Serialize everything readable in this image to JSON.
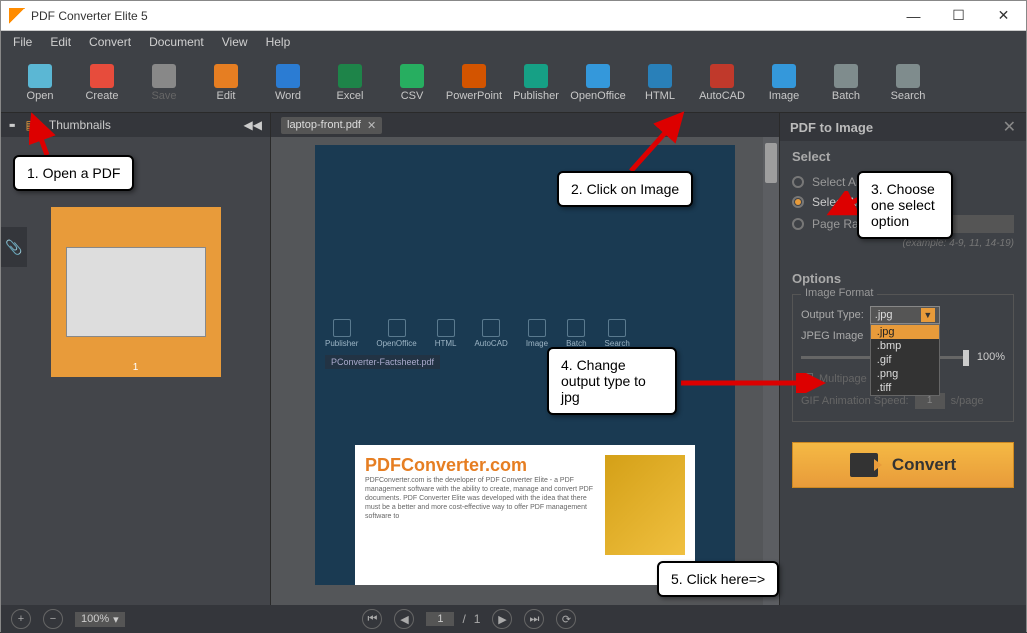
{
  "app": {
    "title": "PDF Converter Elite 5"
  },
  "menu": [
    "File",
    "Edit",
    "Convert",
    "Document",
    "View",
    "Help"
  ],
  "toolbar": [
    {
      "label": "Open",
      "color": "#5bb7d4",
      "icon": "folder"
    },
    {
      "label": "Create",
      "color": "#e74c3c",
      "icon": "pdf"
    },
    {
      "label": "Save",
      "color": "#888",
      "icon": "disk",
      "disabled": true
    },
    {
      "label": "Edit",
      "color": "#e67e22",
      "icon": "pencil"
    },
    {
      "label": "Word",
      "color": "#2b7cd3",
      "icon": "W"
    },
    {
      "label": "Excel",
      "color": "#1e8449",
      "icon": "X"
    },
    {
      "label": "CSV",
      "color": "#27ae60",
      "icon": "csv"
    },
    {
      "label": "PowerPoint",
      "color": "#d35400",
      "icon": "P"
    },
    {
      "label": "Publisher",
      "color": "#16a085",
      "icon": "Pb"
    },
    {
      "label": "OpenOffice",
      "color": "#3498db",
      "icon": "OO"
    },
    {
      "label": "HTML",
      "color": "#2980b9",
      "icon": "<>"
    },
    {
      "label": "AutoCAD",
      "color": "#c0392b",
      "icon": "A"
    },
    {
      "label": "Image",
      "color": "#3498db",
      "icon": "img"
    },
    {
      "label": "Batch",
      "color": "#7f8c8d",
      "icon": "gear"
    },
    {
      "label": "Search",
      "color": "#7f8c8d",
      "icon": "mag"
    }
  ],
  "thumbnails": {
    "title": "Thumbnails",
    "page_num": "1"
  },
  "document": {
    "tab_name": "laptop-front.pdf",
    "inner_toolbar": [
      "Publisher",
      "OpenOffice",
      "HTML",
      "AutoCAD",
      "Image",
      "Batch",
      "Search"
    ],
    "inner_tab": "PConverter-Factsheet.pdf",
    "content_logo": "PDFConverter.com",
    "content_text": "PDFConverter.com is the developer of PDF Converter Elite - a PDF management software with the ability to create, manage and convert PDF documents.\n\nPDF Converter Elite was developed with the idea that there must be a better and more cost-effective way to offer PDF management software to"
  },
  "sidebar": {
    "header": "PDF to Image",
    "select_title": "Select",
    "select_area": "Select Area",
    "select_all": "Select All Pages",
    "page_range": "Page Range",
    "example": "(example: 4-9, 11, 14-19)",
    "options_title": "Options",
    "image_format": "Image Format",
    "output_type_label": "Output Type:",
    "output_type_value": ".jpg",
    "dropdown_options": [
      ".jpg",
      ".bmp",
      ".gif",
      ".png",
      ".tiff"
    ],
    "jpeg_quality": "JPEG Image",
    "slider_value": "100%",
    "multipage": "Multipage Image",
    "gif_speed_label": "GIF Animation Speed:",
    "gif_speed_value": "1",
    "gif_speed_unit": "s/page",
    "convert": "Convert"
  },
  "status": {
    "zoom": "100%",
    "page_current": "1",
    "page_total": "1"
  },
  "callouts": {
    "c1": "1. Open a PDF",
    "c2": "2. Click on Image",
    "c3": "3. Choose one select option",
    "c4": "4. Change output type to jpg",
    "c5": "5. Click here=>"
  }
}
